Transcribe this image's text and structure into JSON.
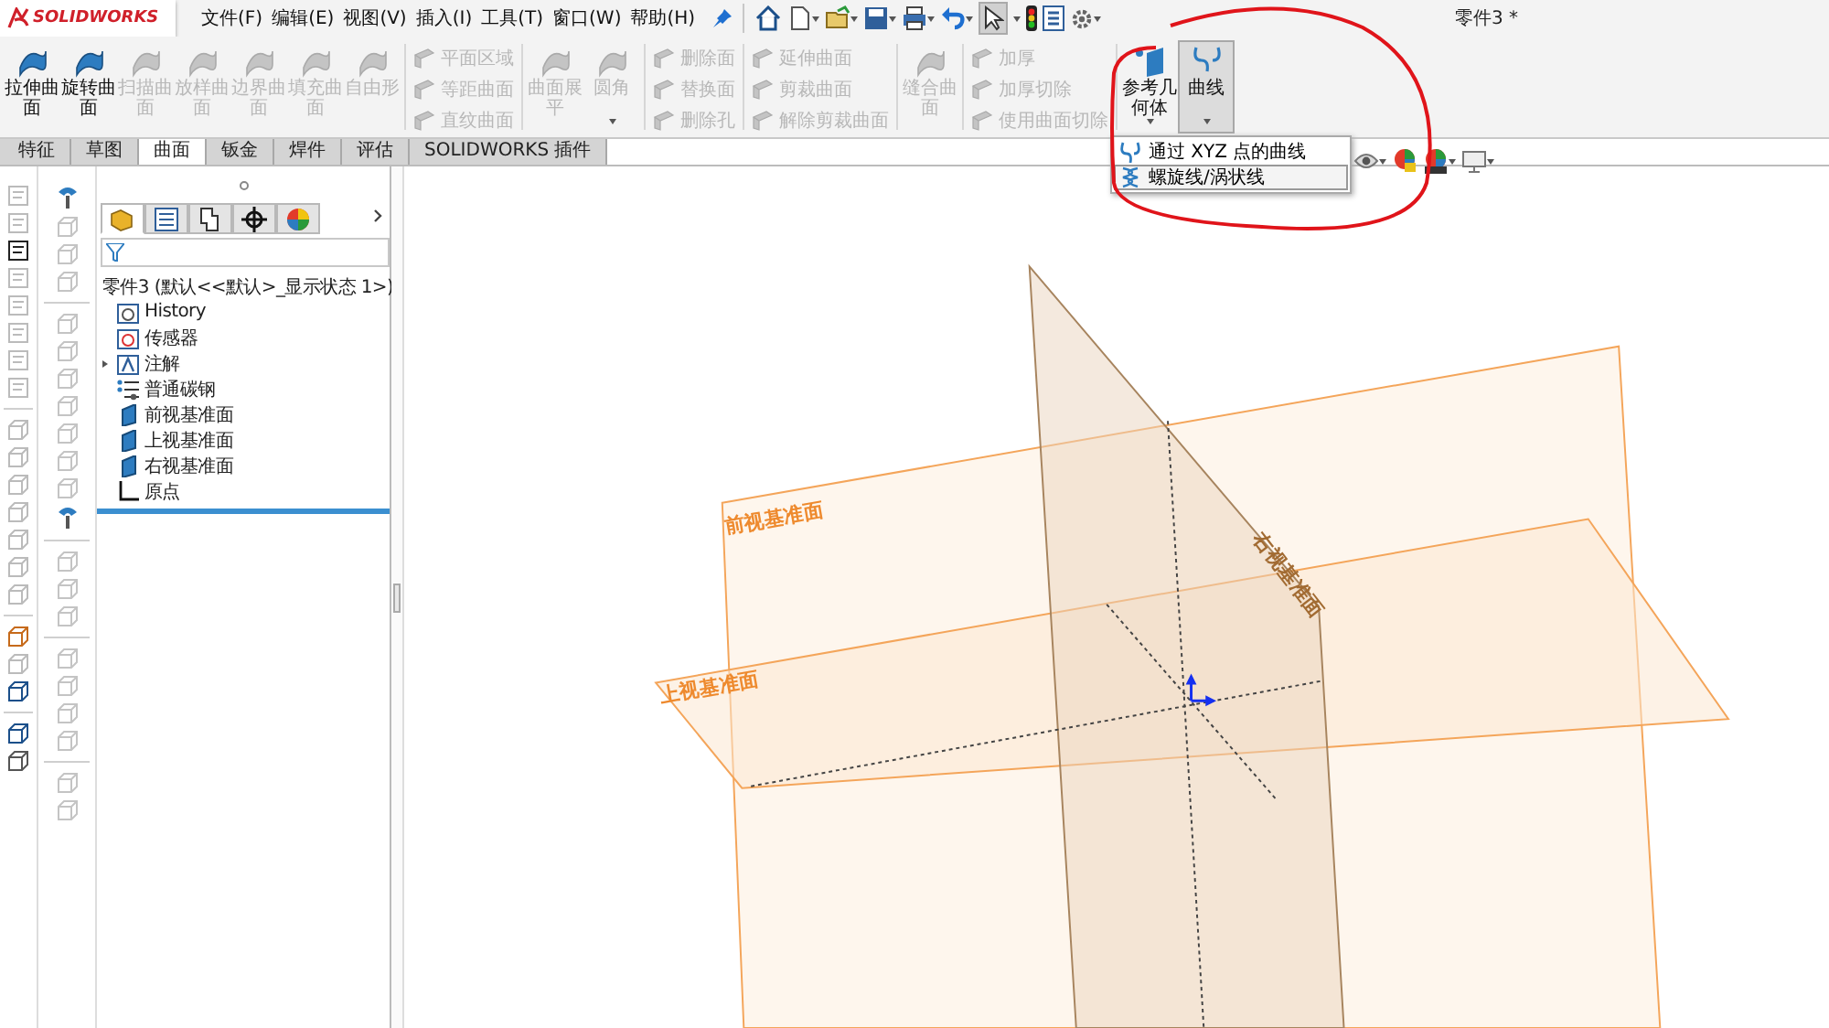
{
  "menu_bar": {
    "logo": "SOLIDWORKS",
    "items": [
      "文件(F)",
      "编辑(E)",
      "视图(V)",
      "插入(I)",
      "工具(T)",
      "窗口(W)",
      "帮助(H)"
    ],
    "document_title": "零件3 *"
  },
  "ribbon": {
    "groups": [
      {
        "kind": "large",
        "items": [
          {
            "label": "拉伸曲面",
            "disabled": false,
            "dropdown": false,
            "pressed": false
          },
          {
            "label": "旋转曲面",
            "disabled": false,
            "dropdown": false,
            "pressed": false
          },
          {
            "label": "扫描曲面",
            "disabled": true,
            "dropdown": false,
            "pressed": false
          },
          {
            "label": "放样曲面",
            "disabled": true,
            "dropdown": false,
            "pressed": false
          },
          {
            "label": "边界曲面",
            "disabled": true,
            "dropdown": false,
            "pressed": false
          },
          {
            "label": "填充曲面",
            "disabled": true,
            "dropdown": false,
            "pressed": false
          },
          {
            "label": "自由形",
            "disabled": true,
            "dropdown": false,
            "pressed": false
          }
        ]
      },
      {
        "kind": "column",
        "items": [
          {
            "label": "平面区域",
            "disabled": true
          },
          {
            "label": "等距曲面",
            "disabled": true
          },
          {
            "label": "直纹曲面",
            "disabled": true
          }
        ]
      },
      {
        "kind": "large",
        "items": [
          {
            "label": "曲面展平",
            "disabled": true,
            "dropdown": false,
            "pressed": false
          },
          {
            "label": "圆角",
            "disabled": true,
            "dropdown": true,
            "pressed": false
          }
        ]
      },
      {
        "kind": "column",
        "items": [
          {
            "label": "删除面",
            "disabled": true
          },
          {
            "label": "替换面",
            "disabled": true
          },
          {
            "label": "删除孔",
            "disabled": true
          }
        ]
      },
      {
        "kind": "column",
        "items": [
          {
            "label": "延伸曲面",
            "disabled": true
          },
          {
            "label": "剪裁曲面",
            "disabled": true
          },
          {
            "label": "解除剪裁曲面",
            "disabled": true
          }
        ]
      },
      {
        "kind": "large",
        "items": [
          {
            "label": "缝合曲面",
            "disabled": true,
            "dropdown": false,
            "pressed": false
          }
        ]
      },
      {
        "kind": "column",
        "items": [
          {
            "label": "加厚",
            "disabled": true
          },
          {
            "label": "加厚切除",
            "disabled": true
          },
          {
            "label": "使用曲面切除",
            "disabled": true
          }
        ]
      },
      {
        "kind": "large",
        "items": [
          {
            "label": "参考几何体",
            "disabled": false,
            "dropdown": true,
            "pressed": false
          },
          {
            "label": "曲线",
            "disabled": false,
            "dropdown": true,
            "pressed": true
          }
        ]
      }
    ]
  },
  "tabs": [
    {
      "label": "特征",
      "selected": false
    },
    {
      "label": "草图",
      "selected": false
    },
    {
      "label": "曲面",
      "selected": true
    },
    {
      "label": "钣金",
      "selected": false
    },
    {
      "label": "焊件",
      "selected": false
    },
    {
      "label": "评估",
      "selected": false
    },
    {
      "label": "SOLIDWORKS 插件",
      "selected": false
    }
  ],
  "curve_menu": {
    "items": [
      {
        "label": "通过 XYZ 点的曲线",
        "selected": false
      },
      {
        "label": "螺旋线/涡状线",
        "selected": true
      }
    ]
  },
  "feature_manager": {
    "tabs": [
      {
        "selected": true
      },
      {
        "selected": false
      },
      {
        "selected": false
      },
      {
        "selected": false
      },
      {
        "selected": false
      }
    ],
    "root": "零件3  (默认<<默认>_显示状态 1>)",
    "nodes": [
      {
        "kind": "history",
        "label": "History",
        "expandable": false
      },
      {
        "kind": "sensor",
        "label": "传感器",
        "expandable": false
      },
      {
        "kind": "annotation",
        "label": "注解",
        "expandable": true
      },
      {
        "kind": "material",
        "label": "普通碳钢",
        "expandable": false
      },
      {
        "kind": "plane",
        "label": "前视基准面",
        "expandable": false
      },
      {
        "kind": "plane",
        "label": "上视基准面",
        "expandable": false
      },
      {
        "kind": "plane",
        "label": "右视基准面",
        "expandable": false
      },
      {
        "kind": "origin",
        "label": "原点",
        "expandable": false
      }
    ]
  },
  "viewport": {
    "plane_labels": [
      "前视基准面",
      "上视基准面",
      "右视基准面"
    ]
  }
}
